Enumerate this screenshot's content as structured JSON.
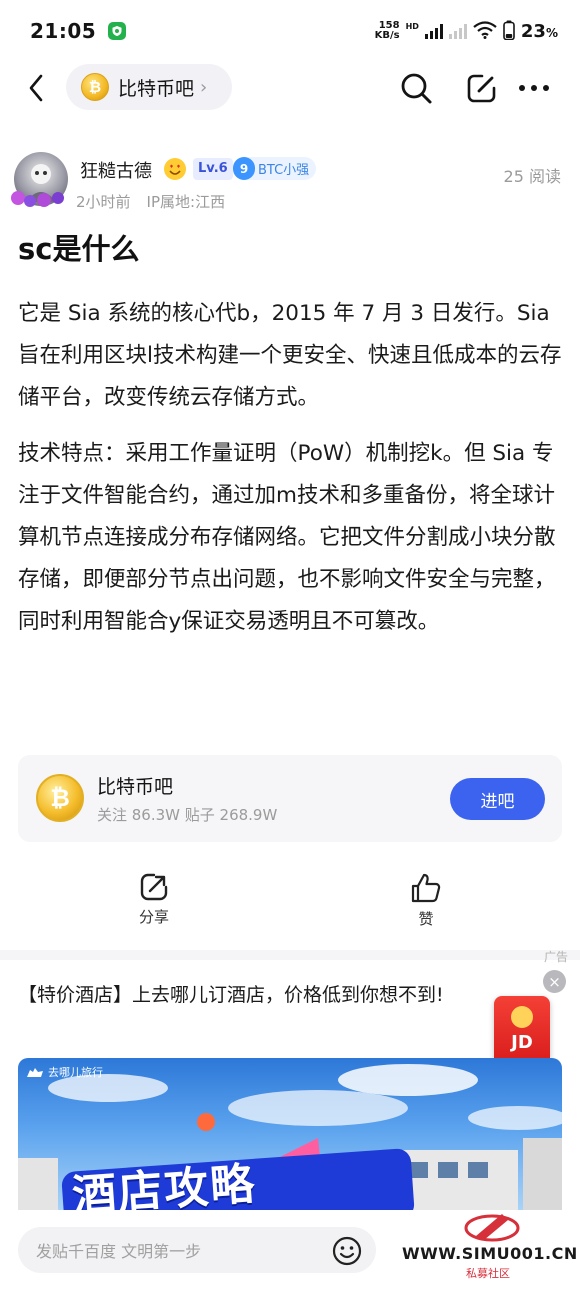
{
  "status_bar": {
    "time": "21:05",
    "net_speed_value": "158",
    "net_speed_unit": "KB/s",
    "hd_label": "HD",
    "battery": "23",
    "battery_unit": "%"
  },
  "header": {
    "forum_name": "比特币吧",
    "chevron": "›"
  },
  "author": {
    "name": "狂糙古德",
    "level": "Lv.6",
    "fan_level": "9",
    "fan_title": "BTC小强",
    "time_ago": "2小时前",
    "ip_location": "IP属地:江西",
    "read_count": "25 阅读"
  },
  "post": {
    "title": "sc是什么",
    "paragraphs": [
      "它是 Sia 系统的核心代b，2015 年 7 月 3 日发行。Sia 旨在利用区块l技术构建一个更安全、快速且低成本的云存储平台，改变传统云存储方式。",
      "技术特点：采用工作量证明（PoW）机制挖k。但 Sia 专注于文件智能合约，通过加m技术和多重备份，将全球计算机节点连接成分布存储网络。它把文件分割成小块分散存储，即便部分节点出问题，也不影响文件安全与完整，同时利用智能合y保证交易透明且不可篡改。"
    ]
  },
  "forum_card": {
    "coin_symbol": "₿",
    "name": "比特币吧",
    "stats": "关注 86.3W   贴子 268.9W",
    "join_label": "进吧"
  },
  "actions": {
    "share_label": "分享",
    "like_label": "赞"
  },
  "ad": {
    "tag": "广告",
    "title": "【特价酒店】上去哪儿订酒店，价格低到你想不到!",
    "close_glyph": "×",
    "jd_label": "JD",
    "brand": "去哪儿旅行",
    "slogan": "酒店攻略"
  },
  "bottom_bar": {
    "reply_placeholder": "发贴千百度 文明第一步",
    "watermark_url": "WWW.SIMU001.CN",
    "watermark_sub": "私募社区"
  },
  "colors": {
    "accent_blue": "#3b63ef",
    "status_green": "#22b14c",
    "coin_gold": "#f3b724",
    "ad_red": "#e02a2a"
  }
}
